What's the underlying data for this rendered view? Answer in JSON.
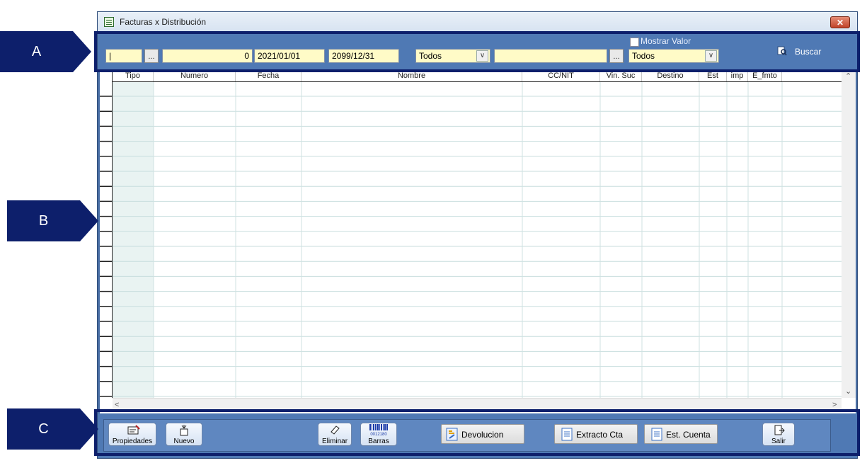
{
  "window": {
    "title": "Facturas x Distribución",
    "close_label": "✕"
  },
  "toolbar": {
    "field1_value": "|",
    "dots_label": "...",
    "number_value": "0",
    "date_from": "2021/01/01",
    "date_to": "2099/12/31",
    "combo1_value": "Todos",
    "field_name_value": "",
    "combo2_value": "Todos",
    "show_value_label": "Mostrar Valor",
    "buscar_label": "Buscar"
  },
  "grid": {
    "columns": [
      "Tipo",
      "Numero",
      "Fecha",
      "Nombre",
      "CC/NIT",
      "Vin. Suc",
      "Destino",
      "Est",
      "imp",
      "E_fmto"
    ]
  },
  "footer": {
    "propiedades_label": "Propiedades",
    "nuevo_label": "Nuevo",
    "eliminar_label": "Eliminar",
    "barras_label": "Barras",
    "barcode_digits": "0012180",
    "devolucion_label": "Devolucion",
    "extracto_label": "Extracto Cta",
    "estcuenta_label": "Est. Cuenta",
    "salir_label": "Salir"
  },
  "annotations": {
    "a": "A",
    "b": "B",
    "c": "C"
  },
  "colors": {
    "callout": "#0d1f6b",
    "toolbar": "#4f79b4",
    "field_bg": "#fffbc7"
  }
}
